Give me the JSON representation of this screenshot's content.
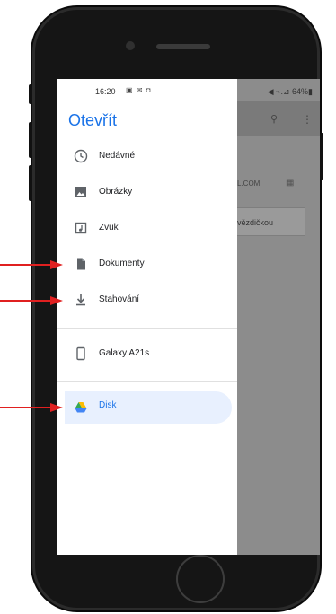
{
  "status_bar": {
    "time": "16:20",
    "notification_icons": "▣ ✉ ◘",
    "right": "◀ ⌁.⊿ 64%▮"
  },
  "drawer": {
    "title": "Otevřít",
    "items": [
      {
        "label": "Nedávné",
        "icon": "clock-icon"
      },
      {
        "label": "Obrázky",
        "icon": "image-icon"
      },
      {
        "label": "Zvuk",
        "icon": "audio-icon"
      },
      {
        "label": "Dokumenty",
        "icon": "document-icon"
      },
      {
        "label": "Stahování",
        "icon": "download-icon"
      }
    ],
    "devices": [
      {
        "label": "Galaxy A21s",
        "icon": "phone-icon"
      }
    ],
    "cloud": [
      {
        "label": "Disk",
        "icon": "google-drive-icon",
        "selected": true
      }
    ]
  },
  "background_content": {
    "account_email_fragment": "L.COM",
    "starred_card_fragment": "vězdičkou",
    "search_icon": "search-icon",
    "more_icon": "more-vert-icon",
    "grid_icon": "grid-view-icon"
  },
  "colors": {
    "accent": "#1a73e8",
    "selected_bg": "#e8f0fe",
    "annotation_arrow": "#e02020"
  }
}
